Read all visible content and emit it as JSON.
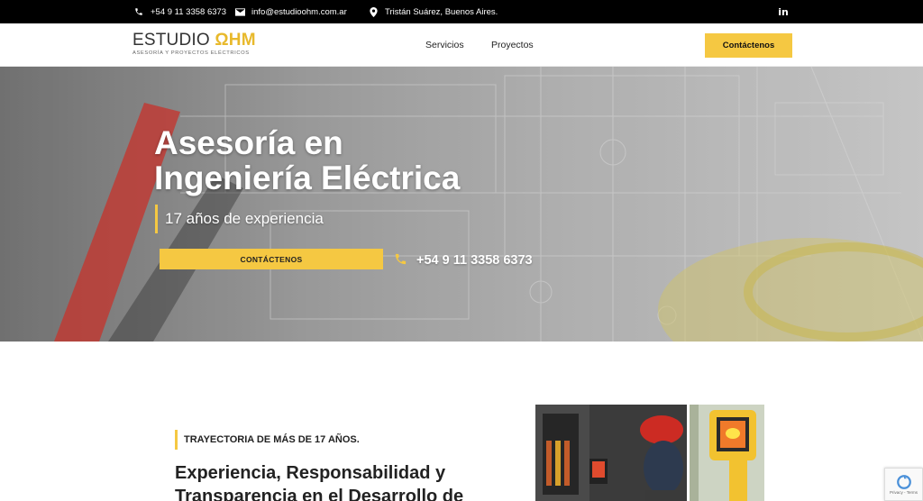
{
  "topbar": {
    "phone": "+54 9 11 3358 6373",
    "email": "info@estudioohm.com.ar",
    "location": "Tristán Suárez, Buenos Aires.",
    "linkedin": "in",
    "icons": [
      "phone-icon",
      "envelope-icon",
      "map-pin-icon",
      "linkedin-icon"
    ]
  },
  "header": {
    "logo_main": "ESTUDIO ",
    "logo_accent": "ΩHM",
    "logo_tagline": "ASESORÍA Y PROYECTOS ELÉCTRICOS",
    "nav": [
      "Servicios",
      "Proyectos"
    ],
    "cta_label": "Contáctenos"
  },
  "hero": {
    "title_line1": "Asesoría en",
    "title_line2": "Ingeniería Eléctrica",
    "subtitle": "17 años de experiencia",
    "button_label": "CONTÁCTENOS",
    "phone": "+54 9 11 3358 6373"
  },
  "about": {
    "kicker": "TRAYECTORIA DE MÁS DE 17 AÑOS.",
    "heading_line1": "Experiencia, Responsabilidad y",
    "heading_line2": "Transparencia en el Desarrollo de"
  },
  "recaptcha": {
    "text": "Privacy - Terms"
  },
  "colors": {
    "accent": "#f5c842",
    "topbar_bg": "#000000",
    "text_dark": "#222222"
  }
}
